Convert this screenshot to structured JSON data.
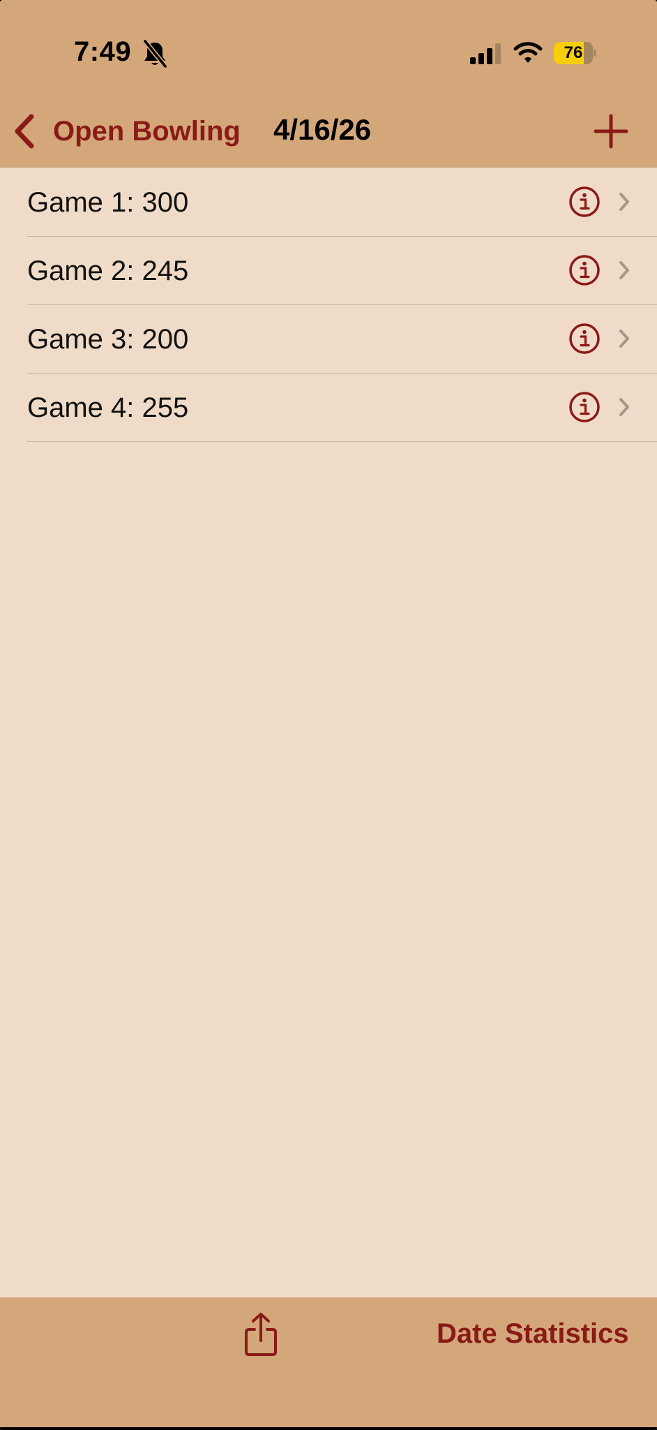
{
  "status_bar": {
    "time": "7:49",
    "battery_level": 76,
    "battery_text": "76",
    "icons": [
      "bell-slash-icon",
      "cellular-signal-icon",
      "wifi-icon",
      "battery-icon"
    ]
  },
  "nav": {
    "back_label": "Open Bowling",
    "title": "4/16/26",
    "add_icon": "plus-icon"
  },
  "games": [
    {
      "label": "Game 1: 300"
    },
    {
      "label": "Game 2: 245"
    },
    {
      "label": "Game 3: 200"
    },
    {
      "label": "Game 4: 255"
    }
  ],
  "toolbar": {
    "share_icon": "share-icon",
    "stats_label": "Date Statistics"
  },
  "colors": {
    "bar_background": "#D4A77A",
    "list_background": "#EFDBC8",
    "accent": "#8A1A17",
    "battery_fill": "#F7CE0A"
  }
}
